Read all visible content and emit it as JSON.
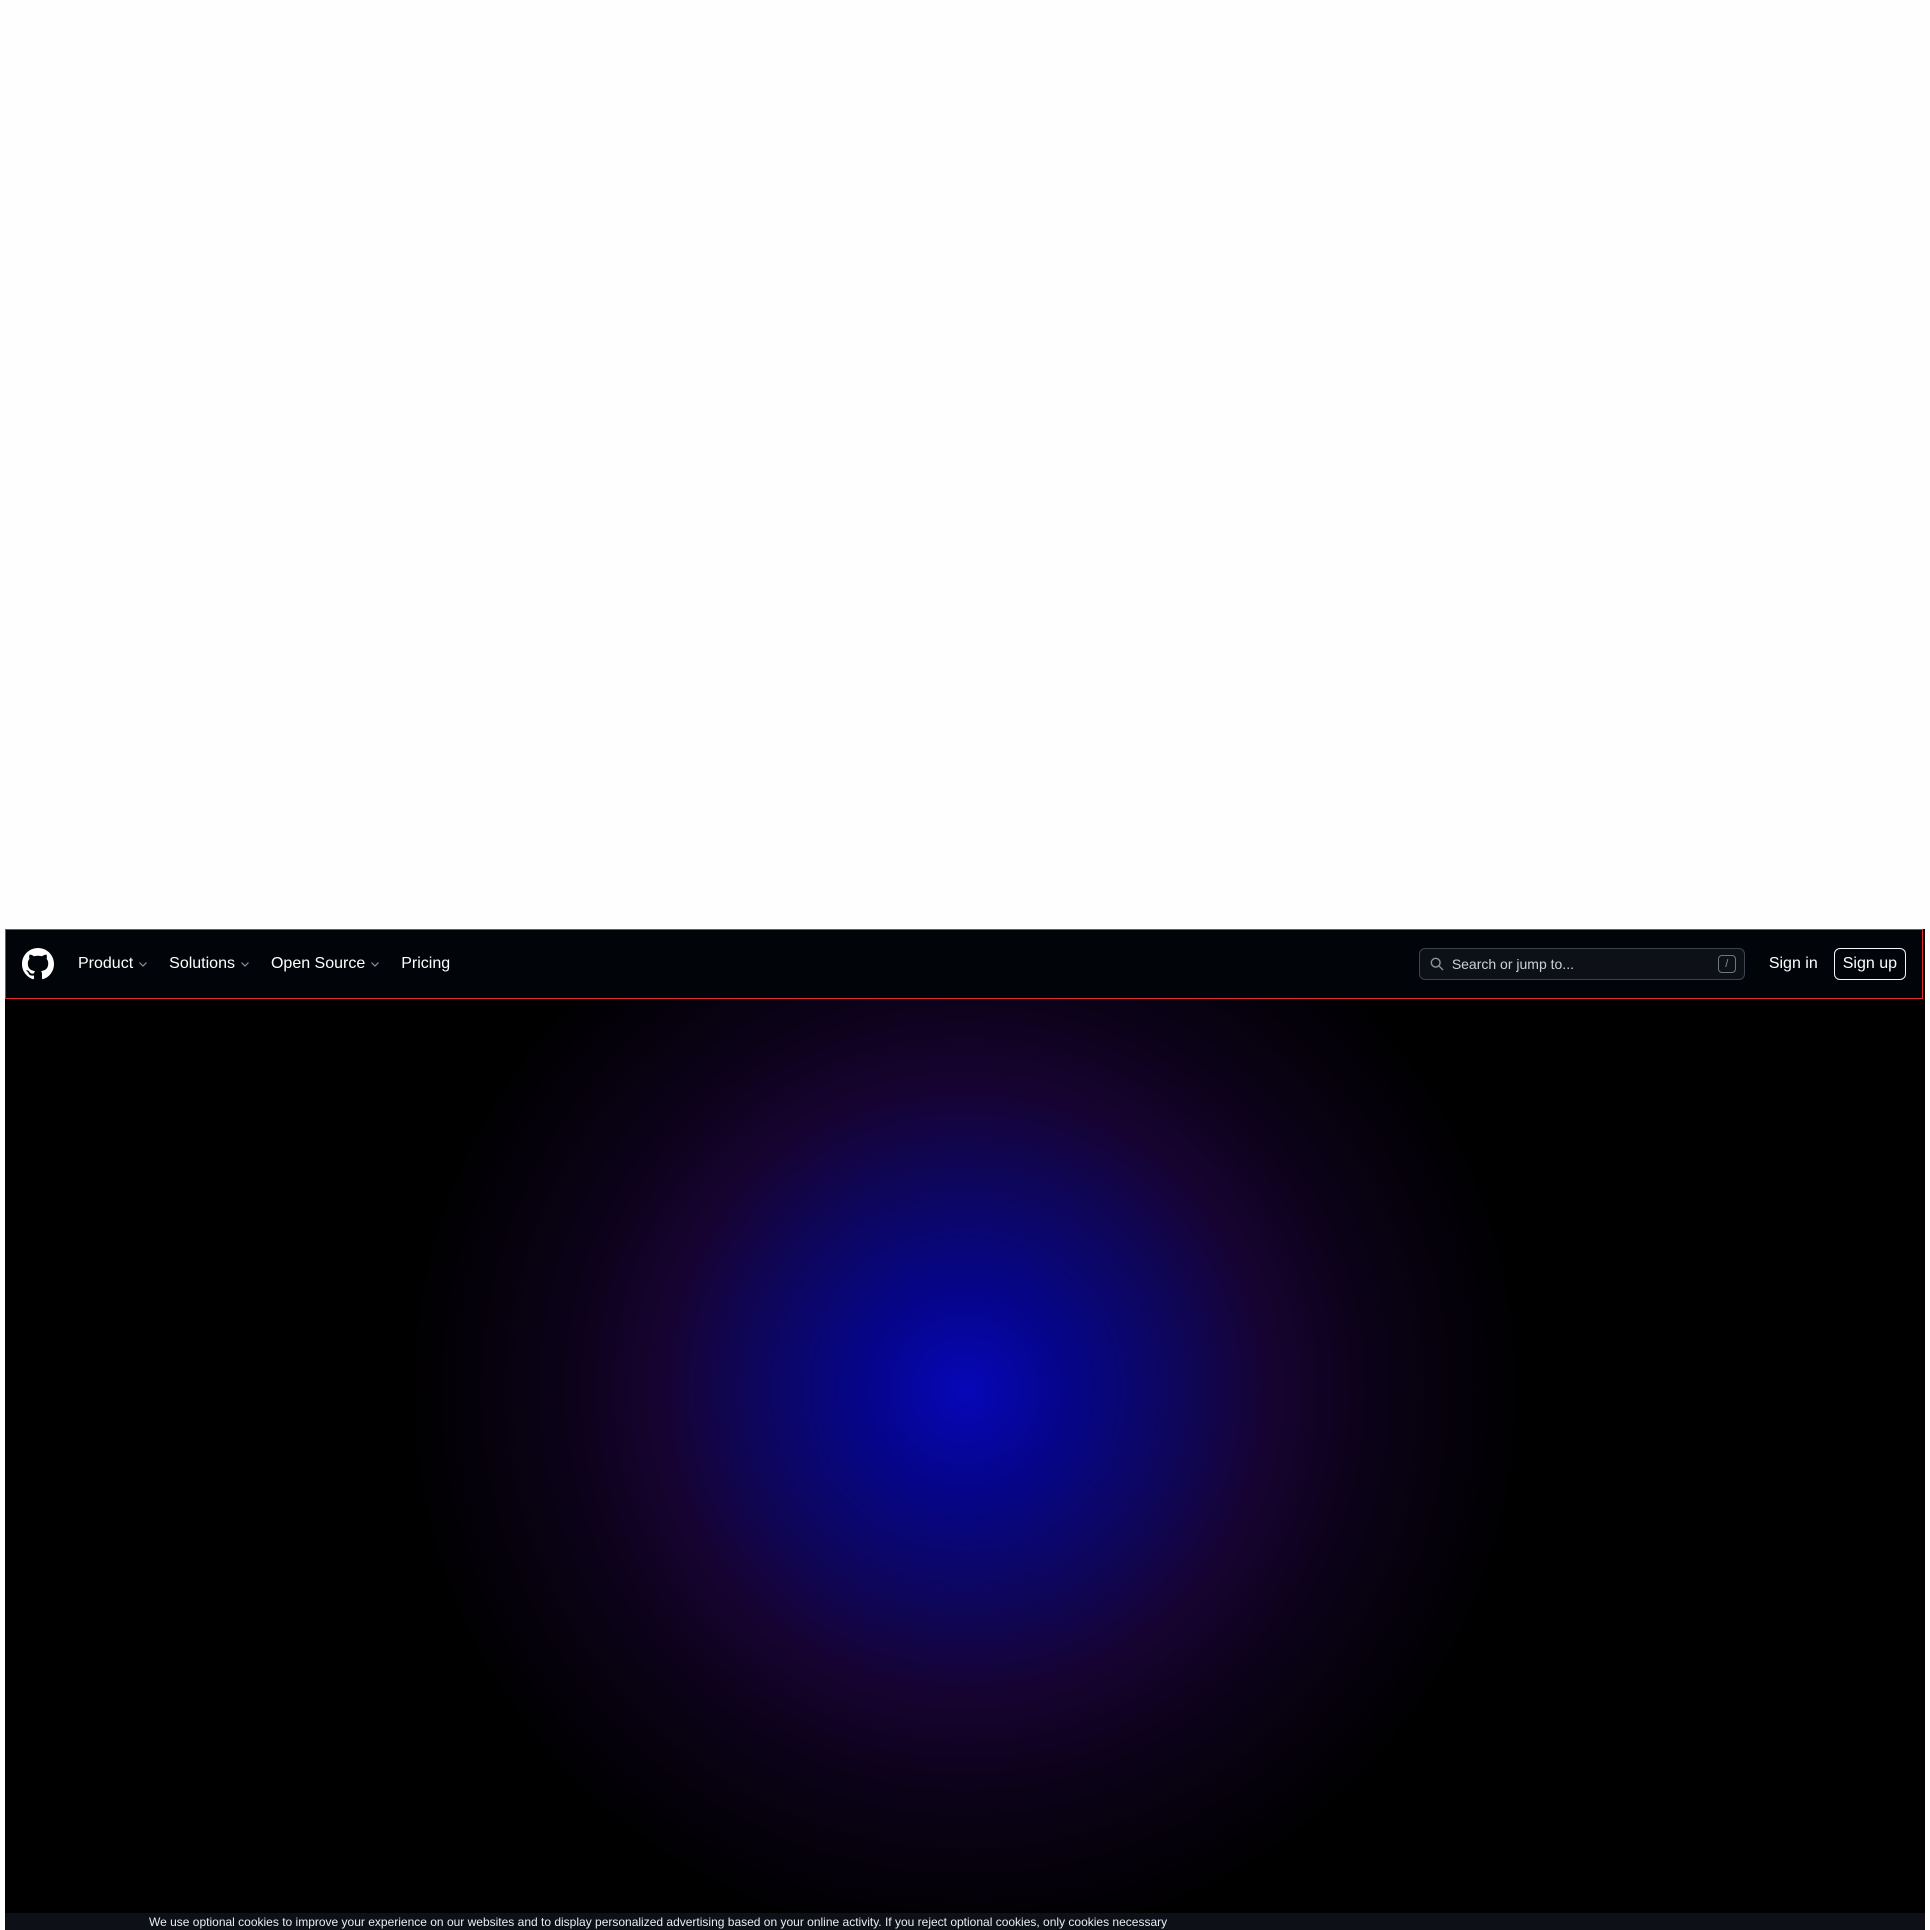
{
  "nav": {
    "items": [
      {
        "label": "Product",
        "has_dropdown": true
      },
      {
        "label": "Solutions",
        "has_dropdown": true
      },
      {
        "label": "Open Source",
        "has_dropdown": true
      },
      {
        "label": "Pricing",
        "has_dropdown": false
      }
    ]
  },
  "search": {
    "placeholder": "Search or jump to...",
    "shortcut": "/"
  },
  "auth": {
    "signin_label": "Sign in",
    "signup_label": "Sign up"
  },
  "cookie_banner": {
    "text": "We use optional cookies to improve your experience on our websites and to display personalized advertising based on your online activity. If you reject optional cookies, only cookies necessary"
  },
  "colors": {
    "header_border": "#e5292e",
    "header_bg": "#010409",
    "hero_center": "#0707b8"
  },
  "icons": [
    "github-logo-icon",
    "chevron-down-icon",
    "search-icon"
  ]
}
